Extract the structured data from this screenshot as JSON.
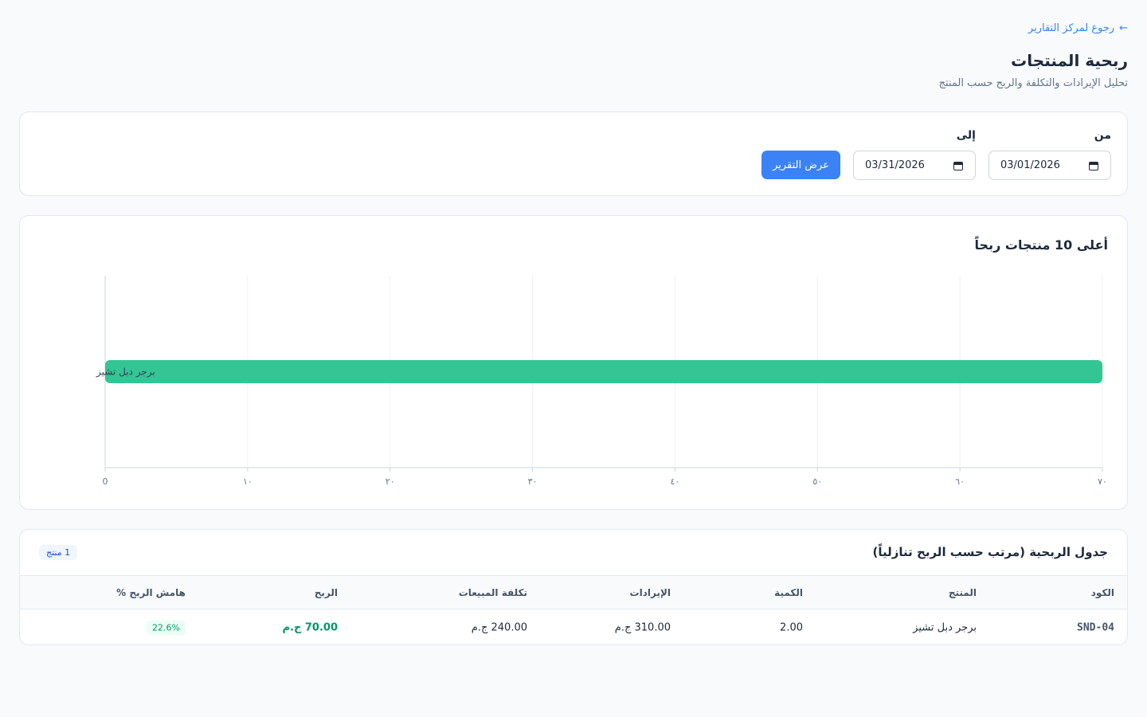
{
  "nav": {
    "back_arrow": "←",
    "back_label": "رجوع لمركز التقارير"
  },
  "header": {
    "title": "ربحية المنتجات",
    "subtitle": "تحليل الإيرادات والتكلفة والربح حسب المنتج"
  },
  "filters": {
    "from_label": "من",
    "from_value": "03/01/2026",
    "to_label": "إلى",
    "to_value": "03/31/2026",
    "submit_label": "عرض التقرير"
  },
  "chart": {
    "title": "أعلى 10 منتجات ربحاً"
  },
  "chart_data": {
    "type": "bar",
    "orientation": "horizontal",
    "categories": [
      "برجر دبل تشيز"
    ],
    "values": [
      70
    ],
    "xlim": [
      0,
      70
    ],
    "xticks": [
      0,
      10,
      20,
      30,
      40,
      50,
      60,
      70
    ],
    "xtick_labels": [
      "0",
      "١٠",
      "٢٠",
      "٣٠",
      "٤٠",
      "٥٠",
      "٦٠",
      "٧٠"
    ],
    "bar_color": "#34c594",
    "grid": true
  },
  "table": {
    "title": "جدول الربحية (مرتب حسب الربح تنازلياً)",
    "count_badge": "1 منتج",
    "columns": {
      "code": "الكود",
      "product": "المنتج",
      "qty": "الكمية",
      "revenue": "الإيرادات",
      "cost": "تكلفة المبيعات",
      "profit": "الربح",
      "margin": "هامش الربح %"
    },
    "rows": [
      {
        "code": "SND-04",
        "product": "برجر دبل تشيز",
        "qty": "2.00",
        "revenue": "310.00 ج.م",
        "cost": "240.00 ج.م",
        "profit": "70.00 ج.م",
        "margin": "22.6%"
      }
    ]
  },
  "colors": {
    "accent": "#3b82f6",
    "profit": "#059669",
    "bar": "#34c594"
  }
}
